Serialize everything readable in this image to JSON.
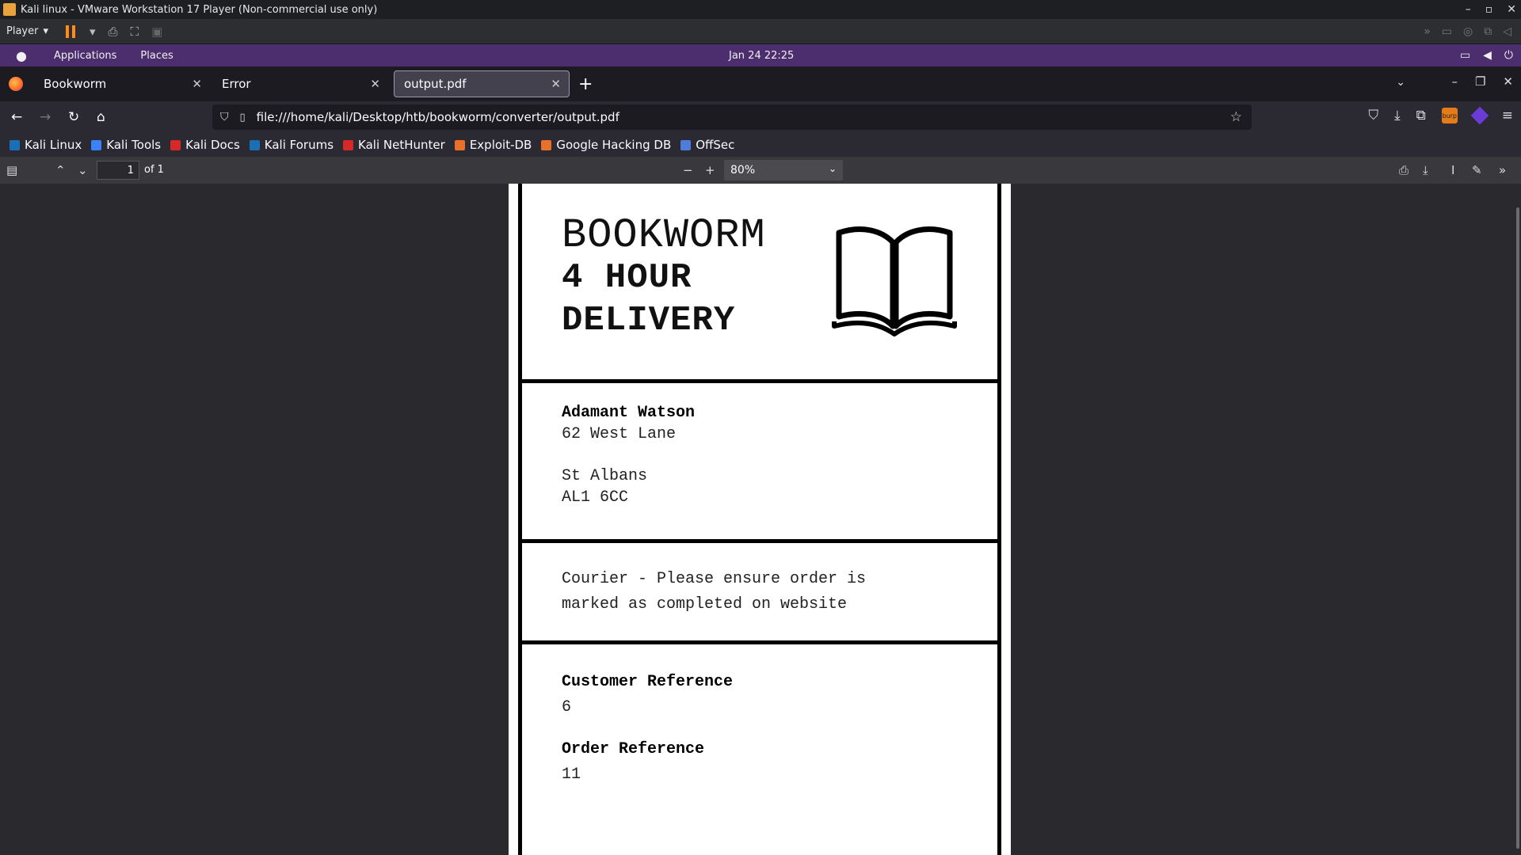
{
  "vmware": {
    "window_title": "Kali linux - VMware Workstation 17 Player (Non-commercial use only)",
    "player_menu": "Player"
  },
  "kali_panel": {
    "applications": "Applications",
    "places": "Places",
    "clock": "Jan 24  22:25"
  },
  "browser": {
    "tabs": [
      {
        "label": "Bookworm"
      },
      {
        "label": "Error"
      },
      {
        "label": "output.pdf"
      }
    ],
    "url": "file:///home/kali/Desktop/htb/bookworm/converter/output.pdf",
    "bookmarks": [
      {
        "label": "Kali Linux",
        "color": "#1b6fb5"
      },
      {
        "label": "Kali Tools",
        "color": "#3b82f6"
      },
      {
        "label": "Kali Docs",
        "color": "#d62828"
      },
      {
        "label": "Kali Forums",
        "color": "#1b6fb5"
      },
      {
        "label": "Kali NetHunter",
        "color": "#d62828"
      },
      {
        "label": "Exploit-DB",
        "color": "#e8702a"
      },
      {
        "label": "Google Hacking DB",
        "color": "#e8702a"
      },
      {
        "label": "OffSec",
        "color": "#4f7bd9"
      }
    ]
  },
  "pdf_viewer": {
    "page_number": "1",
    "page_count": "of 1",
    "zoom": "80%"
  },
  "document": {
    "brand": "BOOKWORM",
    "headline_line1": "4 HOUR",
    "headline_line2": "DELIVERY",
    "customer_name": "Adamant Watson",
    "address_line1": "62 West Lane",
    "address_city": "St Albans",
    "address_postcode": "AL1 6CC",
    "courier_note_line1": "Courier - Please ensure order is",
    "courier_note_line2": "marked as completed on website",
    "customer_ref_label": "Customer Reference",
    "customer_ref_value": "6",
    "order_ref_label": "Order Reference",
    "order_ref_value": "11"
  }
}
